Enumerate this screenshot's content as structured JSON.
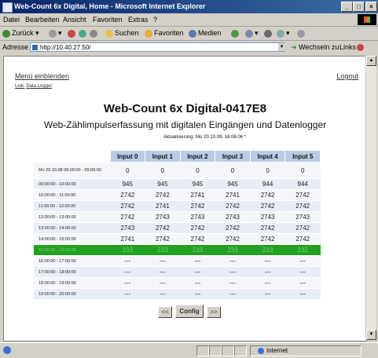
{
  "window": {
    "title": "Web-Count 6x Digital, Home - Microsoft Internet Explorer",
    "buttons": {
      "minimize": "_",
      "maximize": "□",
      "close": "×"
    }
  },
  "menu": [
    "Datei",
    "Bearbeiten",
    "Ansicht",
    "Favoriten",
    "Extras",
    "?"
  ],
  "toolbar": {
    "back": "Zurück",
    "search": "Suchen",
    "favorites": "Favoriten",
    "media": "Medien"
  },
  "address": {
    "label": "Adresse",
    "url": "http://10.40.27.50/",
    "go": "Wechseln zu",
    "links": "Links"
  },
  "page": {
    "menu_link": "Menü einblenden",
    "sub_prefix": "Link:",
    "sub_link": "Data Logger",
    "logout": "Logout",
    "title": "Web-Count 6x Digital-0417E8",
    "subtitle": "Web-Zählimpulserfassung mit digitalen Eingängen und Datenlogger",
    "updated": "Aktualisierung: Mo 20.10.09, 16:06:06 *"
  },
  "table": {
    "headers": [
      "",
      "Input 0",
      "Input 1",
      "Input 2",
      "Input 3",
      "Input 4",
      "Input 5"
    ],
    "rows": [
      {
        "time": "Mo 20.10.08 08:00:00 - 09:00:00",
        "values": [
          "0",
          "0",
          "0",
          "0",
          "0",
          "0"
        ],
        "style": "first"
      },
      {
        "time": "09:00:00 - 10:00:00",
        "values": [
          "945",
          "945",
          "945",
          "945",
          "944",
          "944"
        ],
        "style": "alt"
      },
      {
        "time": "10:00:00 - 11:00:00",
        "values": [
          "2742",
          "2742",
          "2741",
          "2741",
          "2742",
          "2742"
        ],
        "style": "plain"
      },
      {
        "time": "11:00:00 - 12:00:00",
        "values": [
          "2742",
          "2741",
          "2742",
          "2742",
          "2742",
          "2742"
        ],
        "style": "alt"
      },
      {
        "time": "12:00:00 - 13:00:00",
        "values": [
          "2742",
          "2743",
          "2743",
          "2743",
          "2743",
          "2743"
        ],
        "style": "plain"
      },
      {
        "time": "13:00:00 - 14:00:00",
        "values": [
          "2743",
          "2742",
          "2742",
          "2742",
          "2742",
          "2742"
        ],
        "style": "alt"
      },
      {
        "time": "14:00:00 - 15:00:00",
        "values": [
          "2741",
          "2742",
          "2742",
          "2742",
          "2742",
          "2742"
        ],
        "style": "plain"
      },
      {
        "time": "15:00:00 - 16:00:00",
        "values": [
          "233",
          "233",
          "233",
          "233",
          "233",
          "232"
        ],
        "style": "hl"
      },
      {
        "time": "16:00:00 - 17:00:00",
        "values": [
          "---",
          "---",
          "---",
          "---",
          "---",
          "---"
        ],
        "style": "plain"
      },
      {
        "time": "17:00:00 - 18:00:00",
        "values": [
          "---",
          "---",
          "---",
          "---",
          "---",
          "---"
        ],
        "style": "alt"
      },
      {
        "time": "18:00:00 - 19:00:00",
        "values": [
          "---",
          "---",
          "---",
          "---",
          "---",
          "---"
        ],
        "style": "plain"
      },
      {
        "time": "19:00:00 - 20:00:00",
        "values": [
          "---",
          "---",
          "---",
          "---",
          "---",
          "---"
        ],
        "style": "alt"
      }
    ]
  },
  "pager": {
    "prev": "<<",
    "current": "Config",
    "next": ">>"
  },
  "status": {
    "zone": "Internet"
  },
  "colors": {
    "header_bg": "#b8cce4",
    "highlight_row": "#22a022",
    "title_bar": "#0a246a"
  }
}
